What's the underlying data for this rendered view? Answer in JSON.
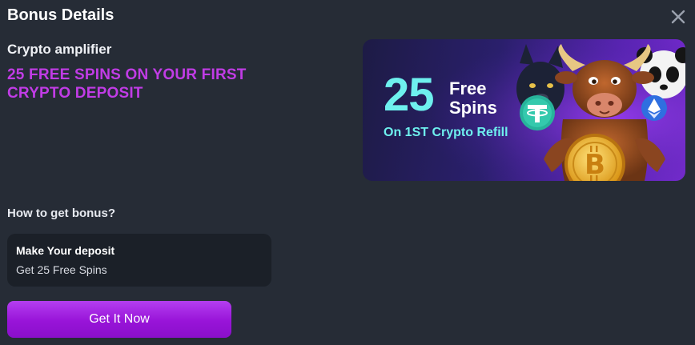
{
  "modal": {
    "title": "Bonus Details",
    "close_icon": "close-icon"
  },
  "bonus": {
    "name": "Crypto amplifier",
    "headline": "25 FREE SPINS ON YOUR FIRST CRYPTO DEPOSIT"
  },
  "banner": {
    "number": "25",
    "free_line1": "Free",
    "free_line2": "Spins",
    "subtitle": "On 1ST Crypto Refill",
    "colors": {
      "accent": "#6ef0ee",
      "background": "#2a1f6c"
    }
  },
  "how_to": {
    "heading": "How to get bonus?",
    "steps": [
      {
        "title": "Make Your deposit",
        "description": "Get 25 Free Spins"
      }
    ]
  },
  "cta": {
    "label": "Get It Now",
    "color": "#9814d8"
  }
}
